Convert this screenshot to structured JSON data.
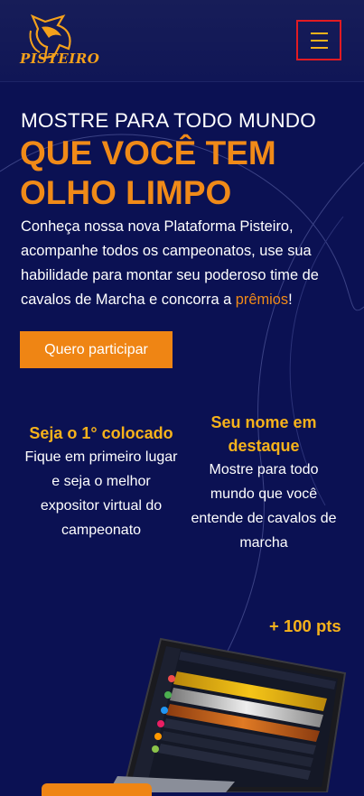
{
  "header": {
    "logo_text": "PISTEIRO",
    "menu_icon": "hamburger-menu-icon"
  },
  "hero": {
    "kicker": "MOSTRE PARA TODO MUNDO",
    "title_line1": "QUE VOCÊ TEM",
    "title_line2": "OLHO LIMPO",
    "desc_line1": "Conheça nossa nova Plataforma Pisteiro,",
    "desc_line2": "acompanhe todos os campeonatos, use sua",
    "desc_line3": "habilidade para montar seu poderoso time de",
    "desc_line4_prefix": "cavalos de Marcha e concorra a ",
    "desc_highlight": "prêmios",
    "desc_line4_suffix": "!",
    "cta_label": "Quero participar"
  },
  "features": [
    {
      "title": "Seja o 1° colocado",
      "lines": [
        "Fique em primeiro lugar",
        "e seja o melhor",
        "expositor virtual do",
        "campeonato"
      ]
    },
    {
      "title_line1": "Seu nome em",
      "title_line2": "destaque",
      "lines": [
        "Mostre para todo",
        "mundo que você",
        "entende de cavalos de",
        "marcha"
      ]
    }
  ],
  "points_badge": "+ 100 pts",
  "colors": {
    "background": "#0b1153",
    "accent_orange": "#f08a18",
    "accent_yellow": "#f6b21b",
    "menu_border": "#e21b22"
  }
}
